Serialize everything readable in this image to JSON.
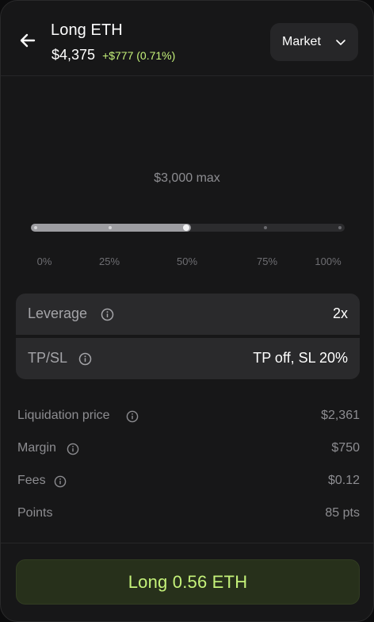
{
  "header": {
    "back_icon": "arrow-left-icon",
    "title": "Long ETH",
    "price": "$4,375",
    "change": "+$777 (0.71%)",
    "change_color": "#c5f27a",
    "order_type": "Market",
    "order_type_icon": "chevron-down-icon"
  },
  "amount": {
    "max_label": "$3,000 max",
    "slider_value_percent": 50,
    "ticks": [
      "0%",
      "25%",
      "50%",
      "75%",
      "100%"
    ]
  },
  "settings": {
    "leverage_label": "Leverage",
    "leverage_value": "2x",
    "tpsl_label": "TP/SL",
    "tpsl_value": "TP off, SL 20%"
  },
  "details": [
    {
      "label": "Liquidation price",
      "value": "$2,361",
      "info": true
    },
    {
      "label": "Margin",
      "value": "$750",
      "info": true
    },
    {
      "label": "Fees",
      "value": "$0.12",
      "info": true
    },
    {
      "label": "Points",
      "value": "85 pts",
      "info": false
    }
  ],
  "cta": {
    "label": "Long 0.56 ETH",
    "accent": "#c5f27a"
  }
}
